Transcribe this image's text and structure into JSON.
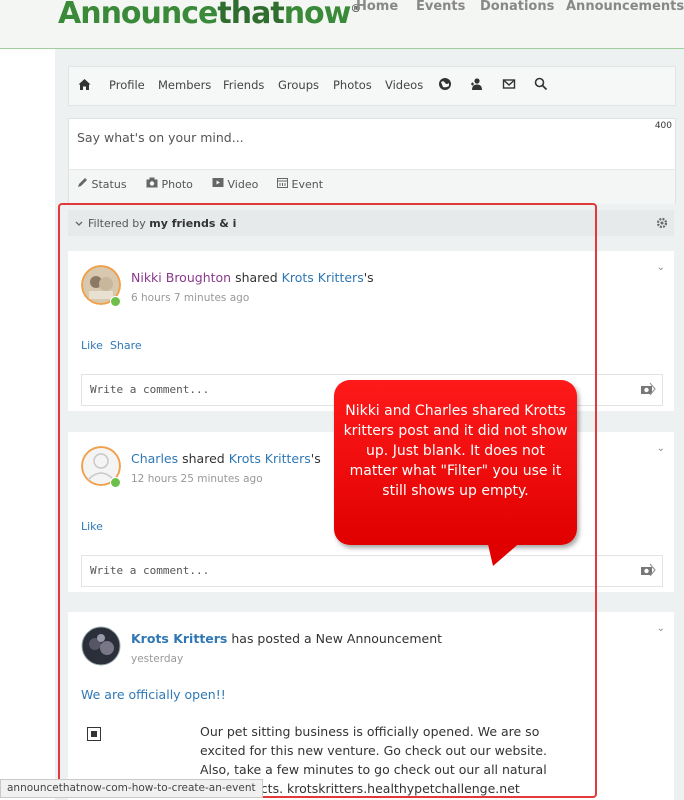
{
  "header": {
    "logo_main": "Announce",
    "logo_that": "that",
    "logo_end": "now",
    "logo_reg": "®",
    "nav": [
      "Home",
      "Events",
      "Donations",
      "Announcements"
    ]
  },
  "subnav": {
    "items": [
      "Profile",
      "Members",
      "Friends",
      "Groups",
      "Photos",
      "Videos"
    ]
  },
  "composer": {
    "placeholder": "Say what's on your mind...",
    "char_count": "400",
    "options": [
      "Status",
      "Photo",
      "Video",
      "Event"
    ]
  },
  "filter": {
    "prefix": "Filtered by",
    "value": "my friends & i"
  },
  "posts": [
    {
      "author": "Nikki Broughton",
      "verb": "shared",
      "target": "Krots Kritters",
      "suffix": "'s",
      "time": "6 hours 7 minutes ago",
      "links": [
        "Like",
        "Share"
      ],
      "comment_placeholder": "Write a comment..."
    },
    {
      "author": "Charles",
      "verb": "shared",
      "target": "Krots Kritters",
      "suffix": "'s",
      "time": "12 hours 25 minutes ago",
      "links": [
        "Like"
      ],
      "comment_placeholder": "Write a comment..."
    },
    {
      "author": "Krots Kritters",
      "verb": "has posted a New Announcement",
      "time": "yesterday",
      "title": "We are officially open!!",
      "body": "Our pet sitting business is officially opened. We are so excited for this new venture. Go check out our website. Also, take a few minutes to go check out our all natural pet products. krotskritters.healthypetchallenge.net"
    }
  ],
  "callout": {
    "text": "Nikki and Charles shared Krotts kritters post and it did not show up. Just blank. It does not matter what \"Filter\" you use it still shows up empty."
  },
  "statusbar": {
    "url": "announcethatnow-com-how-to-create-an-event"
  },
  "colors": {
    "brand_green": "#3a8a3a",
    "link_blue": "#2f78b5",
    "author_purple": "#8b3a8b",
    "online_green": "#6cc04a",
    "annotation_red": "#e23a3a"
  }
}
